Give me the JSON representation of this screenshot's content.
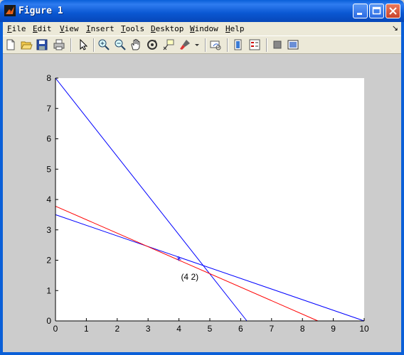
{
  "window": {
    "title": "Figure 1",
    "app_icon": "matlab-icon",
    "controls": [
      "minimize-icon",
      "maximize-icon",
      "close-icon"
    ]
  },
  "menu": {
    "items": [
      "File",
      "Edit",
      "View",
      "Insert",
      "Tools",
      "Desktop",
      "Window",
      "Help"
    ],
    "dock_icon": "dock-arrow-icon"
  },
  "toolbar": {
    "buttons": [
      "new-figure-icon",
      "open-file-icon",
      "save-icon",
      "print-icon",
      "edit-plot-arrow-icon",
      "zoom-in-icon",
      "zoom-out-icon",
      "pan-hand-icon",
      "rotate-3d-icon",
      "data-cursor-icon",
      "brush-icon",
      "brush-dropdown-icon",
      "link-plot-icon",
      "insert-colorbar-icon",
      "insert-legend-icon",
      "hide-plot-tools-icon",
      "show-plot-tools-icon"
    ]
  },
  "chart_data": {
    "type": "line",
    "title": "",
    "xlabel": "",
    "ylabel": "",
    "xlim": [
      0,
      10
    ],
    "ylim": [
      0,
      8
    ],
    "xticks": [
      0,
      1,
      2,
      3,
      4,
      5,
      6,
      7,
      8,
      9,
      10
    ],
    "yticks": [
      0,
      1,
      2,
      3,
      4,
      5,
      6,
      7,
      8
    ],
    "grid": false,
    "series": [
      {
        "color": "#0000ff",
        "x": [
          0,
          6.2
        ],
        "y": [
          8,
          0
        ]
      },
      {
        "color": "#0000ff",
        "x": [
          0,
          10
        ],
        "y": [
          3.5,
          0
        ]
      },
      {
        "color": "#ff0000",
        "x": [
          0,
          8.5
        ],
        "y": [
          3.78,
          0
        ]
      }
    ],
    "markers": [
      {
        "x": 4,
        "y": 2,
        "symbol": "*",
        "color": "#0000ff"
      }
    ],
    "annotations": [
      {
        "text": "(4  2)",
        "x": 4.35,
        "y": 1.45
      }
    ]
  }
}
